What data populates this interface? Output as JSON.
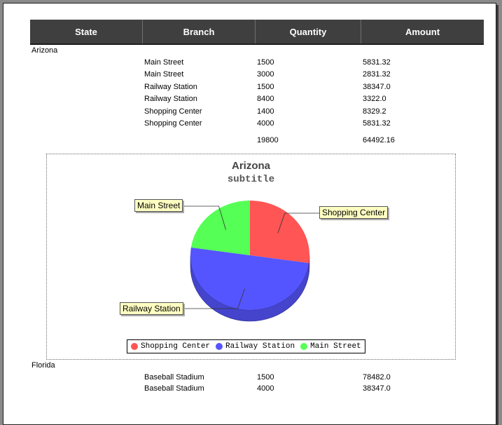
{
  "table": {
    "headers": [
      "State",
      "Branch",
      "Quantity",
      "Amount"
    ]
  },
  "groups": [
    {
      "state": "Arizona",
      "rows": [
        {
          "branch": "Main Street",
          "quantity": "1500",
          "amount": "5831.32"
        },
        {
          "branch": "Main Street",
          "quantity": "3000",
          "amount": "2831.32"
        },
        {
          "branch": "Railway Station",
          "quantity": "1500",
          "amount": "38347.0"
        },
        {
          "branch": "Railway Station",
          "quantity": "8400",
          "amount": "3322.0"
        },
        {
          "branch": "Shopping Center",
          "quantity": "1400",
          "amount": "8329.2"
        },
        {
          "branch": "Shopping Center",
          "quantity": "4000",
          "amount": "5831.32"
        }
      ],
      "total_quantity": "19800",
      "total_amount": "64492.16"
    },
    {
      "state": "Florida",
      "rows": [
        {
          "branch": "Baseball Stadium",
          "quantity": "1500",
          "amount": "78482.0"
        },
        {
          "branch": "Baseball Stadium",
          "quantity": "4000",
          "amount": "38347.0"
        }
      ]
    }
  ],
  "chart_data": {
    "type": "pie",
    "title": "Arizona",
    "subtitle": "subtitle",
    "labels": [
      "Shopping Center",
      "Railway Station",
      "Main Street"
    ],
    "values": [
      5400,
      9900,
      4500
    ],
    "colors": [
      "#ff5555",
      "#5555ff",
      "#55ff55"
    ],
    "legend_position": "bottom"
  }
}
